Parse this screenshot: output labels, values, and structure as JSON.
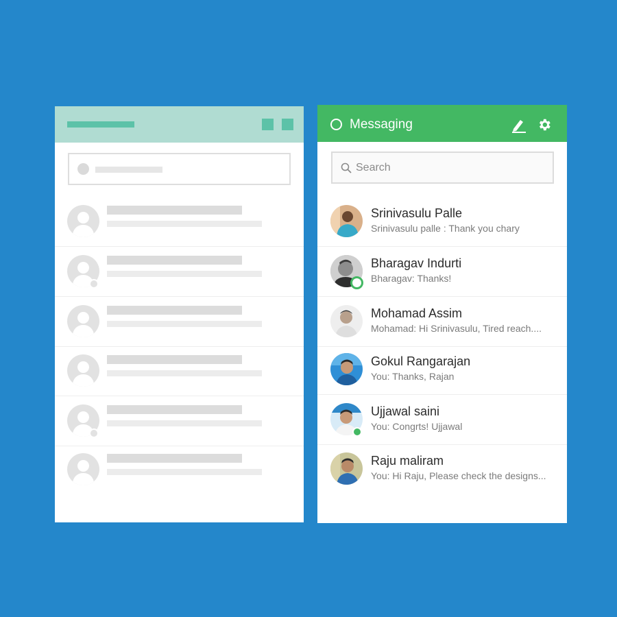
{
  "colors": {
    "background": "#2487cb",
    "accent": "#43b863",
    "wire_header": "#b0dcd2",
    "wire_accent": "#5cc2a8"
  },
  "header": {
    "title": "Messaging",
    "icons": [
      "status-circle-icon",
      "compose-icon",
      "gear-icon"
    ]
  },
  "search": {
    "placeholder": "Search"
  },
  "conversations": [
    {
      "name": "Srinivasulu Palle",
      "preview": "Srinivasulu palle : Thank you chary",
      "status": "none"
    },
    {
      "name": "Bharagav Indurti",
      "preview": "Bharagav: Thanks!",
      "status": "online-ring"
    },
    {
      "name": "Mohamad Assim",
      "preview": "Mohamad: Hi Srinivasulu, Tired reach....",
      "status": "none"
    },
    {
      "name": "Gokul Rangarajan",
      "preview": "You: Thanks, Rajan",
      "status": "none"
    },
    {
      "name": "Ujjawal saini",
      "preview": "You: Congrts! Ujjawal",
      "status": "online"
    },
    {
      "name": "Raju maliram",
      "preview": "You: Hi Raju, Please check the designs...",
      "status": "none"
    }
  ]
}
